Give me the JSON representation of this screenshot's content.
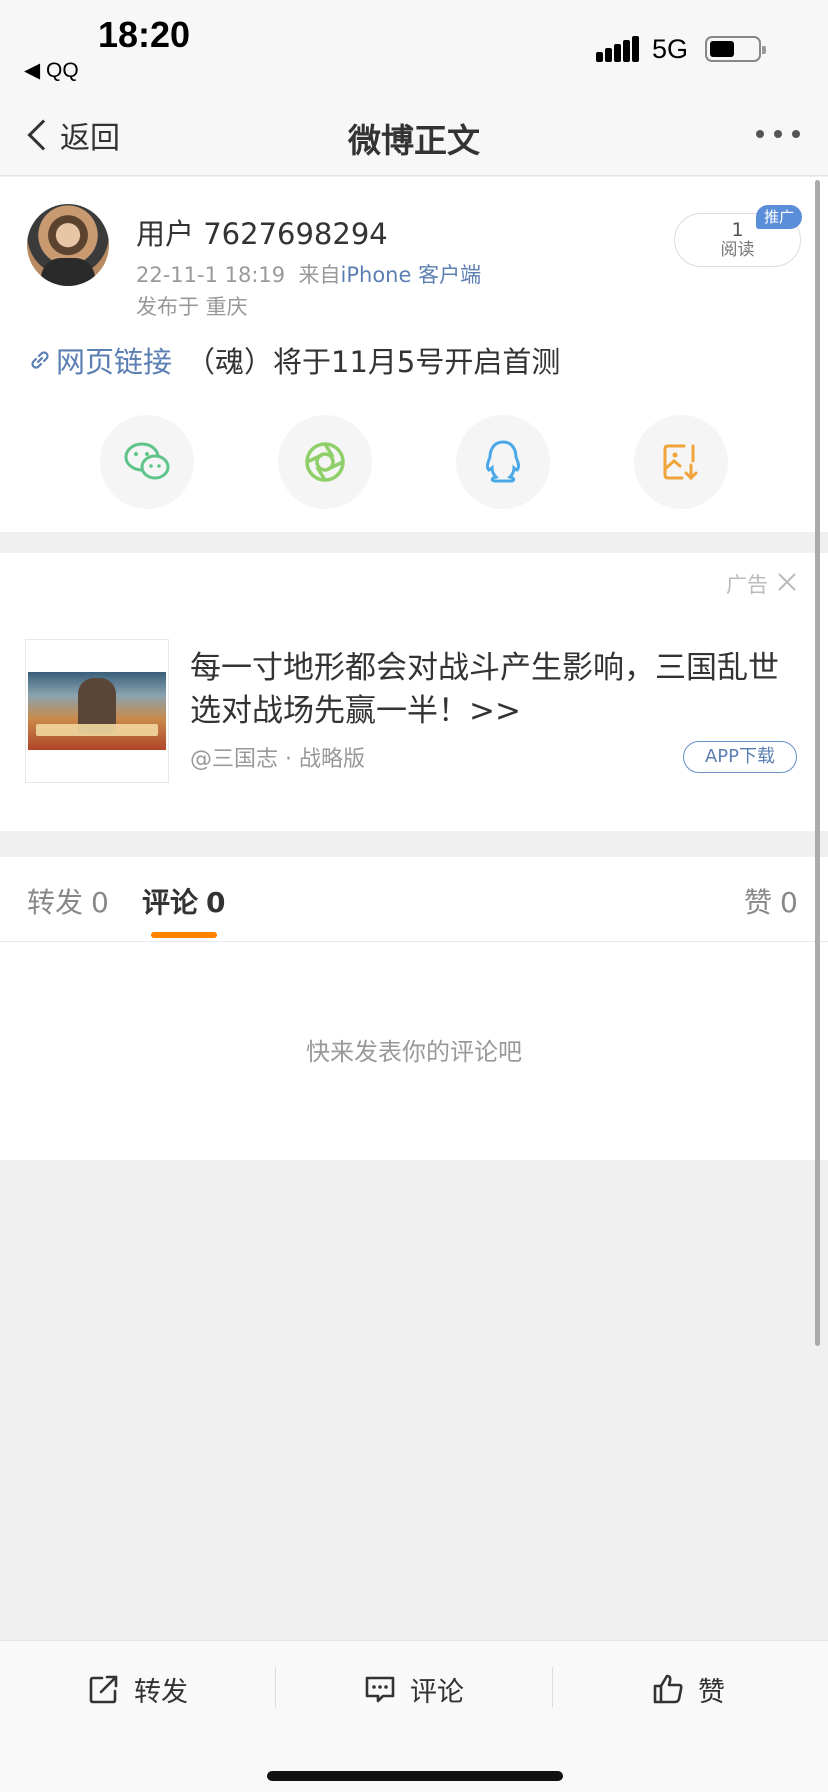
{
  "status_bar": {
    "time": "18:20",
    "back_app": "◀ QQ",
    "network": "5G"
  },
  "nav": {
    "back_label": "返回",
    "title": "微博正文"
  },
  "post": {
    "username": "用户 7627698294",
    "timestamp": "22-11-1 18:19",
    "source_prefix": "来自",
    "source": "iPhone 客户端",
    "location": "发布于 重庆",
    "read_count": "1",
    "read_label": "阅读",
    "promo_badge": "推广",
    "link_text": "网页链接",
    "content": "（魂）将于11月5号开启首测",
    "share_targets": [
      "wechat-icon",
      "moments-icon",
      "qq-icon",
      "save-image-icon"
    ]
  },
  "ad": {
    "label": "广告",
    "title": "每一寸地形都会对战斗产生影响，三国乱世选对战场先赢一半！>>",
    "source": "@三国志 · 战略版",
    "button": "APP下载"
  },
  "tabs": [
    {
      "label": "转发",
      "count": "0"
    },
    {
      "label": "评论",
      "count": "0"
    },
    {
      "label": "赞",
      "count": "0"
    }
  ],
  "empty_comments": "快来发表你的评论吧",
  "toolbar": {
    "repost": "转发",
    "comment": "评论",
    "like": "赞"
  },
  "colors": {
    "link": "#5b7fb2",
    "accent": "#ff8200",
    "promo": "#5a8ed8"
  }
}
